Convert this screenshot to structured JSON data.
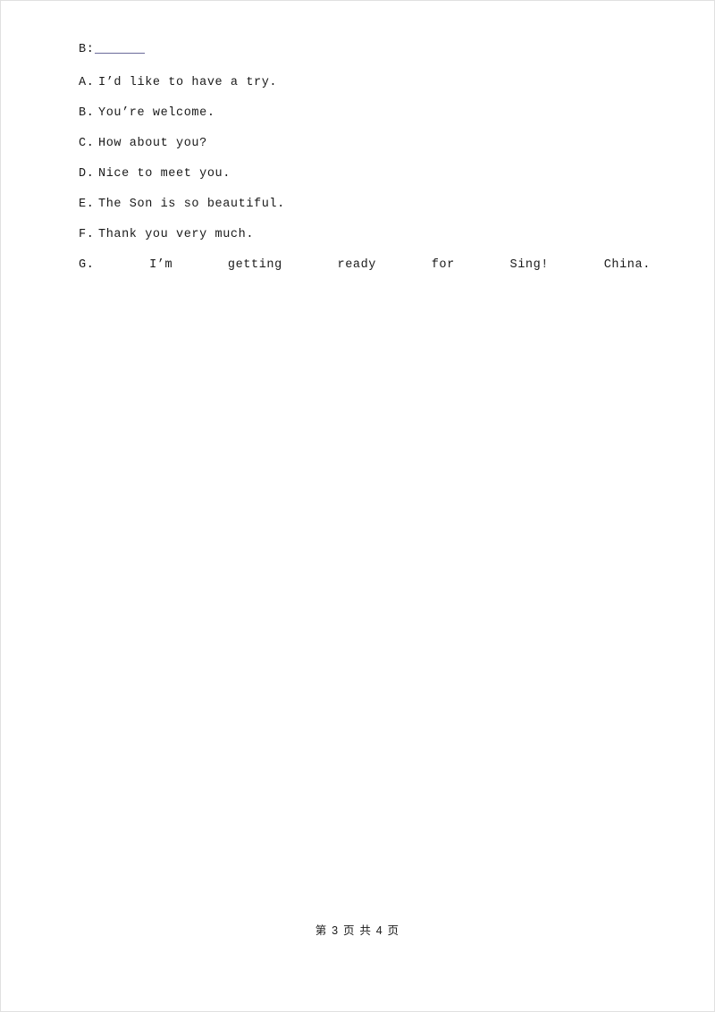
{
  "document": {
    "prompt": {
      "speaker": "B:",
      "blank": ""
    },
    "options": [
      {
        "label": "A.",
        "text": "I’d like to have a try."
      },
      {
        "label": "B.",
        "text": "You’re welcome."
      },
      {
        "label": "C.",
        "text": "How about you?"
      },
      {
        "label": "D.",
        "text": "Nice to meet you."
      },
      {
        "label": "E.",
        "text": "The Son is so beautiful."
      },
      {
        "label": "F.",
        "text": "Thank you very much."
      }
    ],
    "option_g": {
      "label": "G.",
      "words": [
        "I’m",
        "getting",
        "ready",
        "for",
        "Sing!",
        "China."
      ]
    },
    "footer": "第 3 页 共 4 页"
  }
}
